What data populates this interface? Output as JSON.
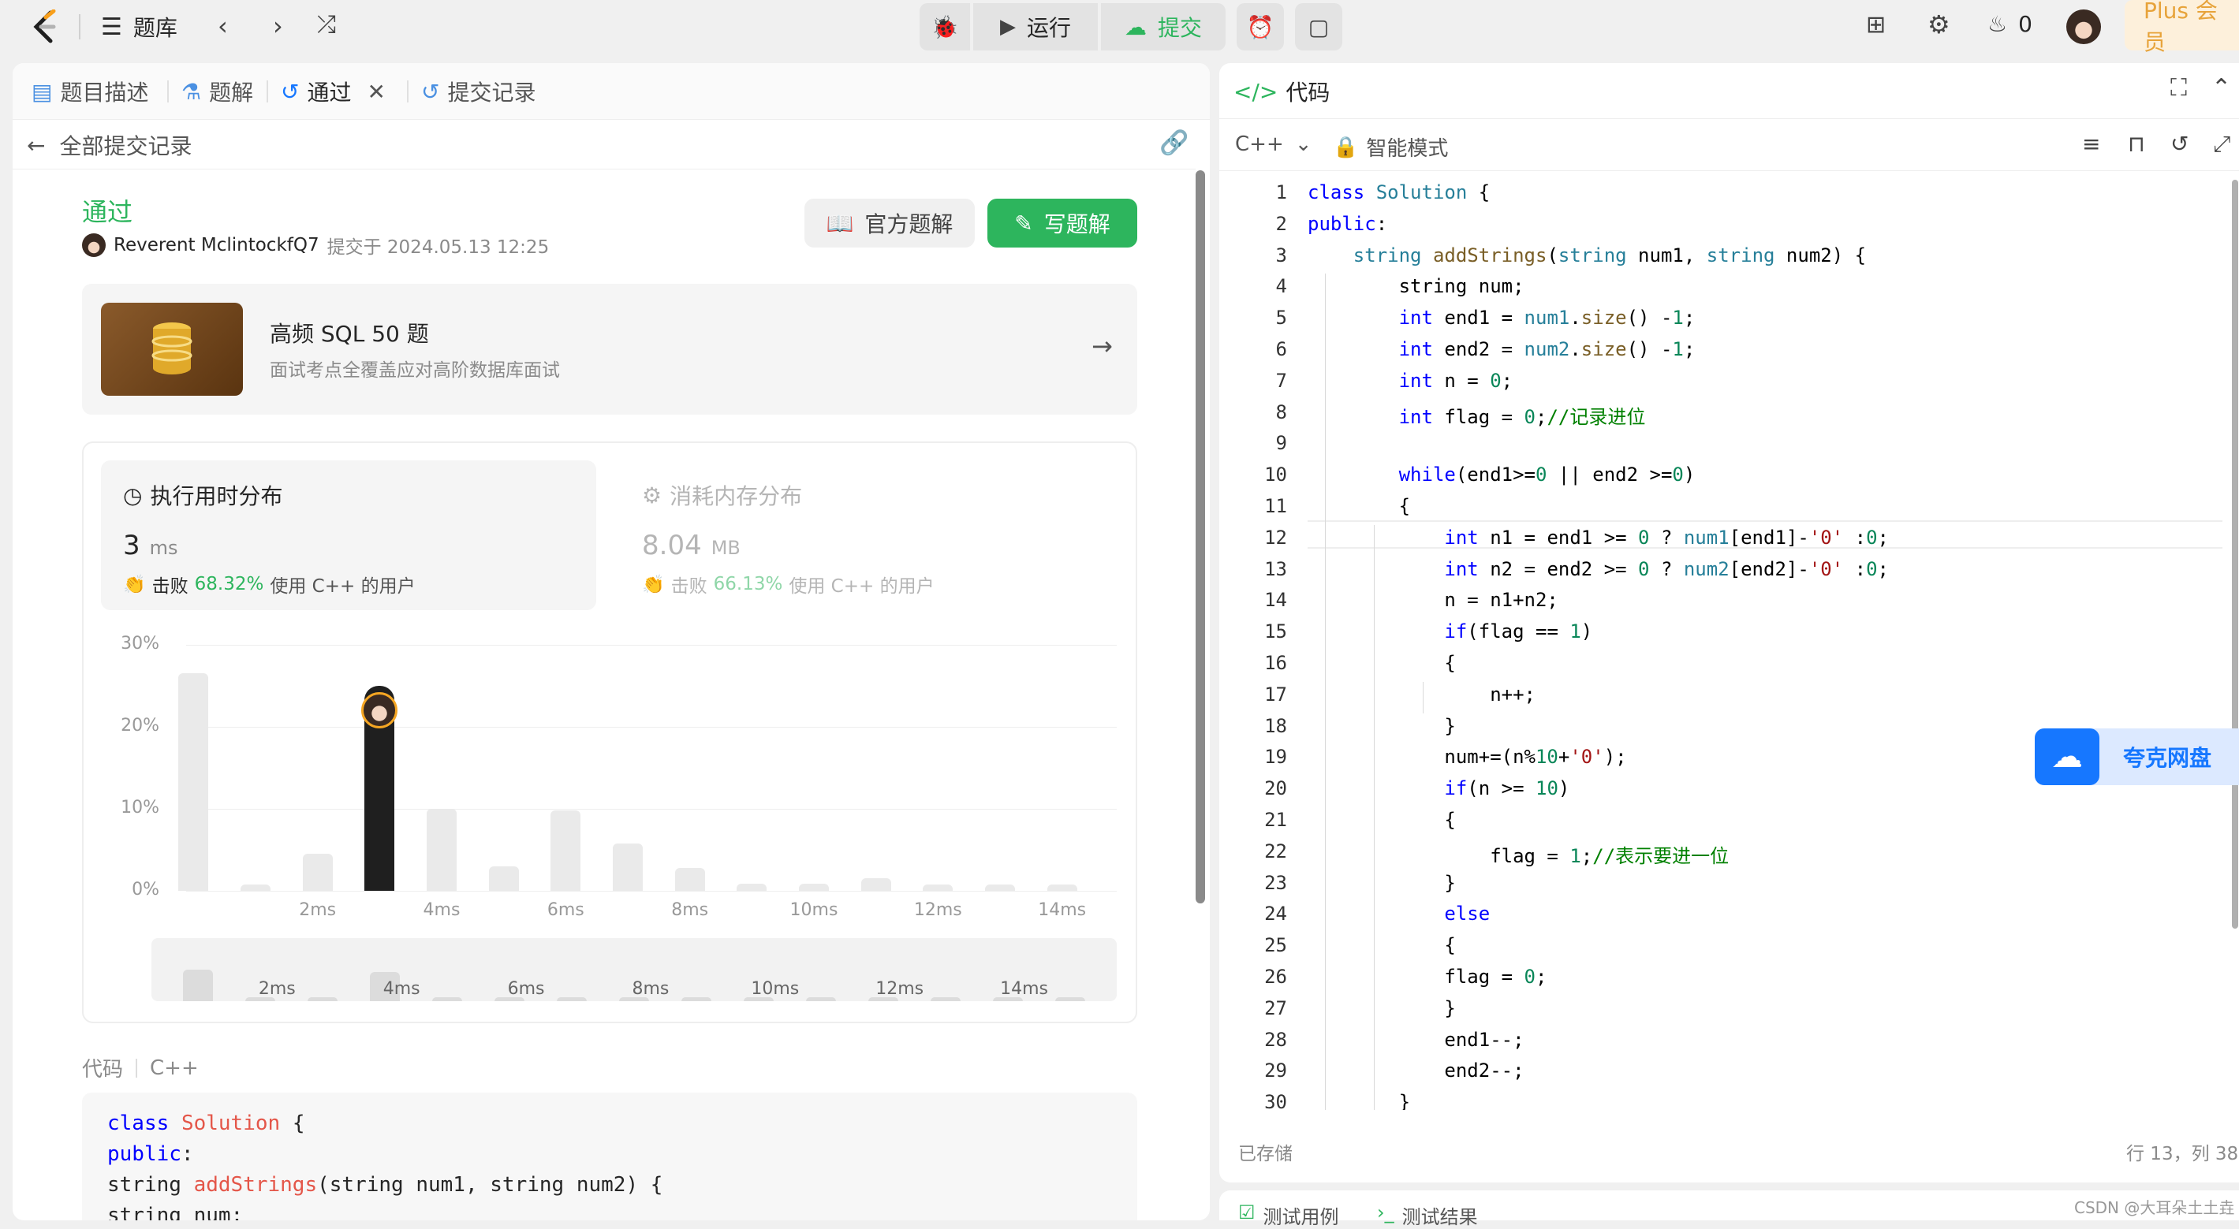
{
  "topbar": {
    "problems_label": "题库",
    "run_label": "运行",
    "submit_label": "提交",
    "streak": "0",
    "plus_label": "Plus 会员"
  },
  "left": {
    "tabs": [
      "题目描述",
      "题解",
      "通过",
      "提交记录"
    ],
    "back_label": "全部提交记录",
    "status": "通过",
    "author": "Reverent MclintockfQ7",
    "submitted": "提交于 2024.05.13 12:25",
    "official_solution_label": "官方题解",
    "write_solution_label": "写题解",
    "promo": {
      "title": "高频 SQL 50 题",
      "subtitle": "面试考点全覆盖应对高阶数据库面试"
    },
    "runtime": {
      "title": "执行用时分布",
      "value": "3",
      "unit": "ms",
      "beat_prefix": "击败",
      "beat_pct": "68.32%",
      "beat_suffix": "使用 C++ 的用户"
    },
    "memory": {
      "title": "消耗内存分布",
      "value": "8.04",
      "unit": "MB",
      "beat_prefix": "击败",
      "beat_pct": "66.13%",
      "beat_suffix": "使用 C++ 的用户"
    },
    "code_label": "代码",
    "lang_label": "C++",
    "code_preview": [
      "class Solution {",
      "public:",
      "    string addStrings(string num1, string num2) {",
      "        string num;"
    ]
  },
  "chart_data": {
    "type": "bar",
    "ylim": [
      0,
      30
    ],
    "yticks": [
      "30%",
      "20%",
      "10%",
      "0%"
    ],
    "xticks": [
      "2ms",
      "4ms",
      "6ms",
      "8ms",
      "10ms",
      "12ms",
      "14ms"
    ],
    "categories": [
      "0ms",
      "1ms",
      "2ms",
      "3ms",
      "4ms",
      "5ms",
      "6ms",
      "7ms",
      "8ms",
      "9ms",
      "10ms",
      "11ms",
      "12ms",
      "13ms",
      "14ms"
    ],
    "values": [
      26.5,
      0.8,
      4.5,
      25,
      10,
      3,
      9.8,
      5.8,
      2.8,
      0.9,
      0.9,
      1.5,
      0.8,
      0.8,
      0.8
    ],
    "highlight": "3ms",
    "minimap_values": [
      6,
      0.8,
      0.8,
      5.5,
      0.8,
      0.8,
      0.8,
      0.8,
      0.8,
      0.8,
      0.8,
      0.8,
      0.8,
      0.8,
      0.8
    ],
    "minimap_ticks": [
      "2ms",
      "4ms",
      "6ms",
      "8ms",
      "10ms",
      "12ms",
      "14ms"
    ]
  },
  "right": {
    "title": "代码",
    "lang": "C++",
    "mode": "智能模式",
    "saved": "已存储",
    "cursor": "行 13，列 38",
    "bottom_tabs": [
      "测试用例",
      "测试结果"
    ],
    "floating": "夸克网盘",
    "watermark": "CSDN @大耳朵土土垚"
  }
}
